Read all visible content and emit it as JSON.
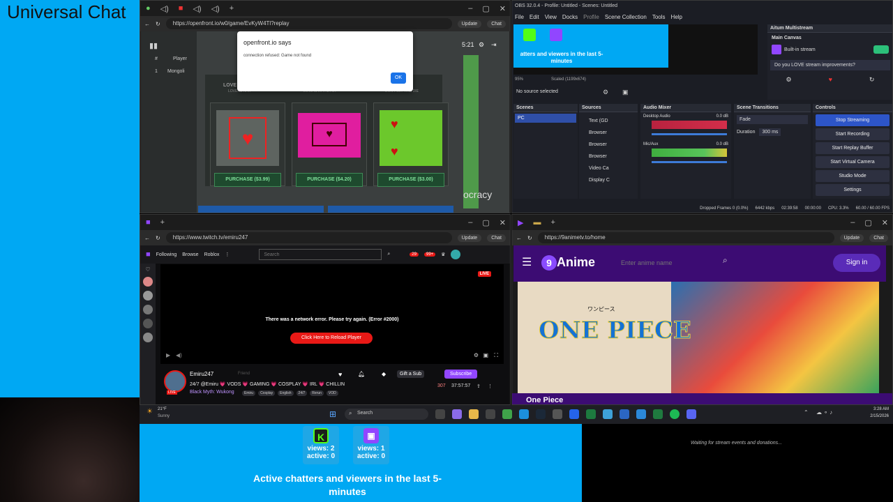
{
  "left_panel": {
    "title": "Universal Chat"
  },
  "game_window": {
    "url": "https://openfront.io/w0/game/EvKyW4Tl?replay",
    "dialog": {
      "title": "openfront.io says",
      "message": "connection refused: Game not found",
      "ok": "OK"
    },
    "leaderboard": {
      "hash": "#",
      "player": "Player",
      "row_rank": "1",
      "row_name": "Mongoli"
    },
    "timer": "5:21",
    "cards": [
      {
        "title": "LOVE C",
        "price": "PURCHASE ($3.99)",
        "sub": "LOVERS RAK"
      },
      {
        "title": "",
        "price": "PURCHASE ($4.20)",
        "sub": "LOVE IS IN THE AIR"
      },
      {
        "title": "",
        "price": "PURCHASE ($3.00)",
        "sub": "DON'T LET THIS DIE"
      }
    ],
    "overlay_text": "ocracy",
    "update_label": "Update",
    "chat_label": "Chat"
  },
  "obs": {
    "title": "OBS 32.0.4 - Profile: Untitled - Scenes: Untitled",
    "menu": [
      "File",
      "Edit",
      "View",
      "Docks",
      "Profile",
      "Scene Collection",
      "Tools",
      "Help"
    ],
    "preview_text": "atters and viewers in the last 5-minutes",
    "preview_k": "views: 2 active: 0",
    "preview_t": "views: 1 active: 0",
    "zoom": "95%",
    "scaled": "Scaled (1199x674)",
    "no_source": "No source selected",
    "scenes_label": "Scenes",
    "scene_item": "PC",
    "sources_label": "Sources",
    "sources": [
      "Text (GD",
      "Browser",
      "Browser",
      "Browser",
      "Video Ca",
      "Display C"
    ],
    "mixer_label": "Audio Mixer",
    "desktop_audio": "Desktop Audio",
    "desktop_db": "0.0 dB",
    "mic_audio": "Mic/Aux",
    "mic_db": "0.0 dB",
    "transitions_label": "Scene Transitions",
    "transition": "Fade",
    "duration_label": "Duration",
    "duration_value": "300 ms",
    "controls_label": "Controls",
    "controls": [
      "Stop Streaming",
      "Start Recording",
      "Start Replay Buffer",
      "Start Virtual Camera",
      "Studio Mode",
      "Settings"
    ],
    "multistream_title": "Aitum Multistream",
    "main_canvas": "Main Canvas",
    "built_in": "Built-in stream",
    "love_improvements": "Do you LOVE stream improvements?",
    "status_dropped": "Dropped Frames 0 (0.0%)",
    "status_kbps": "6442 kbps",
    "status_time": "02:39:58",
    "status_rec": "00:00:00",
    "status_cpu": "CPU: 3.3%",
    "status_fps": "60.00 / 60.00 FPS"
  },
  "twitch": {
    "url": "https://www.twitch.tv/emiru247",
    "nav": [
      "Following",
      "Browse",
      "Roblox"
    ],
    "search_placeholder": "Search",
    "badge1": "29",
    "badge2": "99+",
    "live": "LIVE",
    "error": "There was a network error. Please try again. (Error #2000)",
    "reload": "Click Here to Reload Player",
    "channel": "Emiru247",
    "friend": "Friend",
    "title": "24/7 @Emiru 💗 VODS 💗 GAMING 💗 COSPLAY 💗 IRL 💗 CHILLIN",
    "game": "Black Myth: Wukong",
    "tags": [
      "Emiru",
      "Cosplay",
      "English",
      "24/7",
      "Rerun",
      "VOD"
    ],
    "gift": "Gift a Sub",
    "subscribe": "Subscribe",
    "viewers": "307",
    "uptime": "37:57:57",
    "avatar_live": "LIVE"
  },
  "anime": {
    "url": "https://9animetv.to/home",
    "logo": "Anime",
    "logo_num": "9",
    "search_placeholder": "Enter anime name",
    "signin": "Sign in",
    "banner_title": "One Piece",
    "banner_logo": "ONE PIECE",
    "banner_jp": "ワンピース"
  },
  "taskbar": {
    "weather_temp": "21°F",
    "weather_desc": "Sunny",
    "search": "Search",
    "time": "3:28 AM",
    "date": "2/15/2026"
  },
  "stats": {
    "k_views": "views: 2",
    "k_active": "active: 0",
    "t_views": "views: 1",
    "t_active": "active: 0",
    "caption": "Active chatters and viewers in the last 5-minutes"
  },
  "events": {
    "waiting": "Waiting for stream events and donations..."
  },
  "colors": {
    "accent_blue": "#00a8f3",
    "twitch_purple": "#9146ff",
    "kick_green": "#53fc18",
    "anime_purple": "#3c0c73"
  }
}
